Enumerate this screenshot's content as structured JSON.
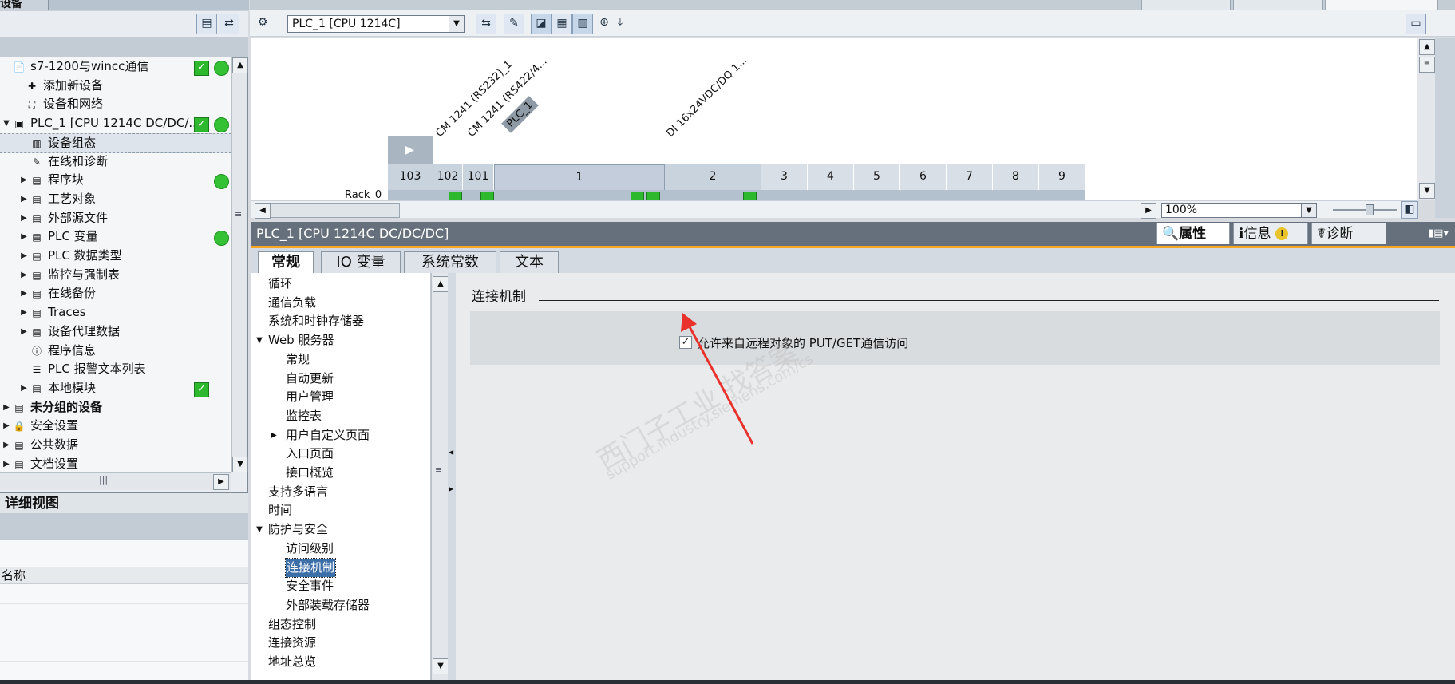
{
  "left_panel": {
    "tab_label": "设备",
    "project_tree": [
      {
        "label": "s7-1200与wincc通信",
        "level": 0,
        "arrow": "",
        "icon": "project-icon",
        "bold": false,
        "ok": true,
        "dot": true
      },
      {
        "label": "添加新设备",
        "level": 1,
        "arrow": "",
        "icon": "add-device-icon",
        "bold": false
      },
      {
        "label": "设备和网络",
        "level": 1,
        "arrow": "",
        "icon": "network-icon",
        "bold": false
      },
      {
        "label": "PLC_1 [CPU 1214C DC/DC/...",
        "level": 0,
        "arrow": "▼",
        "icon": "plc-icon",
        "bold": false,
        "ok": true,
        "dot": true
      },
      {
        "label": "设备组态",
        "level": 2,
        "arrow": "",
        "icon": "device-config-icon",
        "bold": false,
        "selected": true
      },
      {
        "label": "在线和诊断",
        "level": 2,
        "arrow": "",
        "icon": "diagnostics-icon",
        "bold": false
      },
      {
        "label": "程序块",
        "level": 2,
        "arrow": "▶",
        "icon": "folder-icon",
        "bold": false,
        "dot": true
      },
      {
        "label": "工艺对象",
        "level": 2,
        "arrow": "▶",
        "icon": "folder-icon",
        "bold": false
      },
      {
        "label": "外部源文件",
        "level": 2,
        "arrow": "▶",
        "icon": "folder-icon",
        "bold": false
      },
      {
        "label": "PLC 变量",
        "level": 2,
        "arrow": "▶",
        "icon": "folder-icon",
        "bold": false,
        "dot": true
      },
      {
        "label": "PLC 数据类型",
        "level": 2,
        "arrow": "▶",
        "icon": "folder-icon",
        "bold": false
      },
      {
        "label": "监控与强制表",
        "level": 2,
        "arrow": "▶",
        "icon": "folder-icon",
        "bold": false
      },
      {
        "label": "在线备份",
        "level": 2,
        "arrow": "▶",
        "icon": "folder-icon",
        "bold": false
      },
      {
        "label": "Traces",
        "level": 2,
        "arrow": "▶",
        "icon": "folder-icon",
        "bold": false
      },
      {
        "label": "设备代理数据",
        "level": 2,
        "arrow": "▶",
        "icon": "folder-icon",
        "bold": false
      },
      {
        "label": "程序信息",
        "level": 2,
        "arrow": "",
        "icon": "info-icon",
        "bold": false
      },
      {
        "label": "PLC 报警文本列表",
        "level": 2,
        "arrow": "",
        "icon": "list-icon",
        "bold": false
      },
      {
        "label": "本地模块",
        "level": 2,
        "arrow": "▶",
        "icon": "folder-icon",
        "bold": false,
        "ok": true
      },
      {
        "label": "未分组的设备",
        "level": 0,
        "arrow": "▶",
        "icon": "folder-icon",
        "bold": true
      },
      {
        "label": "安全设置",
        "level": 0,
        "arrow": "▶",
        "icon": "security-icon",
        "bold": false
      },
      {
        "label": "公共数据",
        "level": 0,
        "arrow": "▶",
        "icon": "folder-icon",
        "bold": false
      },
      {
        "label": "文档设置",
        "level": 0,
        "arrow": "▶",
        "icon": "folder-icon",
        "bold": false
      }
    ],
    "detail_view_title": "详细视图",
    "detail_column_name": "名称"
  },
  "device_view": {
    "device_select": "PLC_1 [CPU 1214C]",
    "zoom": "100%",
    "slot_labels": [
      "CM 1241 (RS232)_1",
      "CM 1241 (RS422/4...",
      "DI 16x24VDC/DQ 1..."
    ],
    "plc_tag": "PLC_1",
    "slots": [
      "103",
      "102",
      "101",
      "1",
      "2",
      "3",
      "4",
      "5",
      "6",
      "7",
      "8",
      "9"
    ],
    "rack_label": "Rack_0"
  },
  "properties": {
    "title": "PLC_1 [CPU 1214C DC/DC/DC]",
    "tabs": {
      "properties": "属性",
      "info": "信息",
      "diagnostics": "诊断"
    },
    "subtabs": [
      "常规",
      "IO 变量",
      "系统常数",
      "文本"
    ],
    "nav": [
      {
        "label": "循环",
        "indent": 0,
        "arrow": ""
      },
      {
        "label": "通信负载",
        "indent": 0,
        "arrow": ""
      },
      {
        "label": "系统和时钟存储器",
        "indent": 0,
        "arrow": ""
      },
      {
        "label": "Web 服务器",
        "indent": 0,
        "arrow": "▼"
      },
      {
        "label": "常规",
        "indent": 1,
        "arrow": ""
      },
      {
        "label": "自动更新",
        "indent": 1,
        "arrow": ""
      },
      {
        "label": "用户管理",
        "indent": 1,
        "arrow": ""
      },
      {
        "label": "监控表",
        "indent": 1,
        "arrow": ""
      },
      {
        "label": "用户自定义页面",
        "indent": 1,
        "arrow": "▶"
      },
      {
        "label": "入口页面",
        "indent": 1,
        "arrow": ""
      },
      {
        "label": "接口概览",
        "indent": 1,
        "arrow": ""
      },
      {
        "label": "支持多语言",
        "indent": 0,
        "arrow": ""
      },
      {
        "label": "时间",
        "indent": 0,
        "arrow": ""
      },
      {
        "label": "防护与安全",
        "indent": 0,
        "arrow": "▼"
      },
      {
        "label": "访问级别",
        "indent": 1,
        "arrow": ""
      },
      {
        "label": "连接机制",
        "indent": 1,
        "arrow": "",
        "selected": true
      },
      {
        "label": "安全事件",
        "indent": 1,
        "arrow": ""
      },
      {
        "label": "外部装载存储器",
        "indent": 1,
        "arrow": ""
      },
      {
        "label": "组态控制",
        "indent": 0,
        "arrow": ""
      },
      {
        "label": "连接资源",
        "indent": 0,
        "arrow": ""
      },
      {
        "label": "地址总览",
        "indent": 0,
        "arrow": ""
      }
    ],
    "section_title": "连接机制",
    "checkbox_label": "允许来自远程对象的 PUT/GET通信访问",
    "checkbox_checked": true,
    "watermark": "西门子工业  找答案",
    "watermark_url": "support.industry.siemens.com/cs"
  },
  "colors": {
    "accent": "#f5a623",
    "arrow": "#e8322b",
    "ok_green": "#2eb82e"
  }
}
